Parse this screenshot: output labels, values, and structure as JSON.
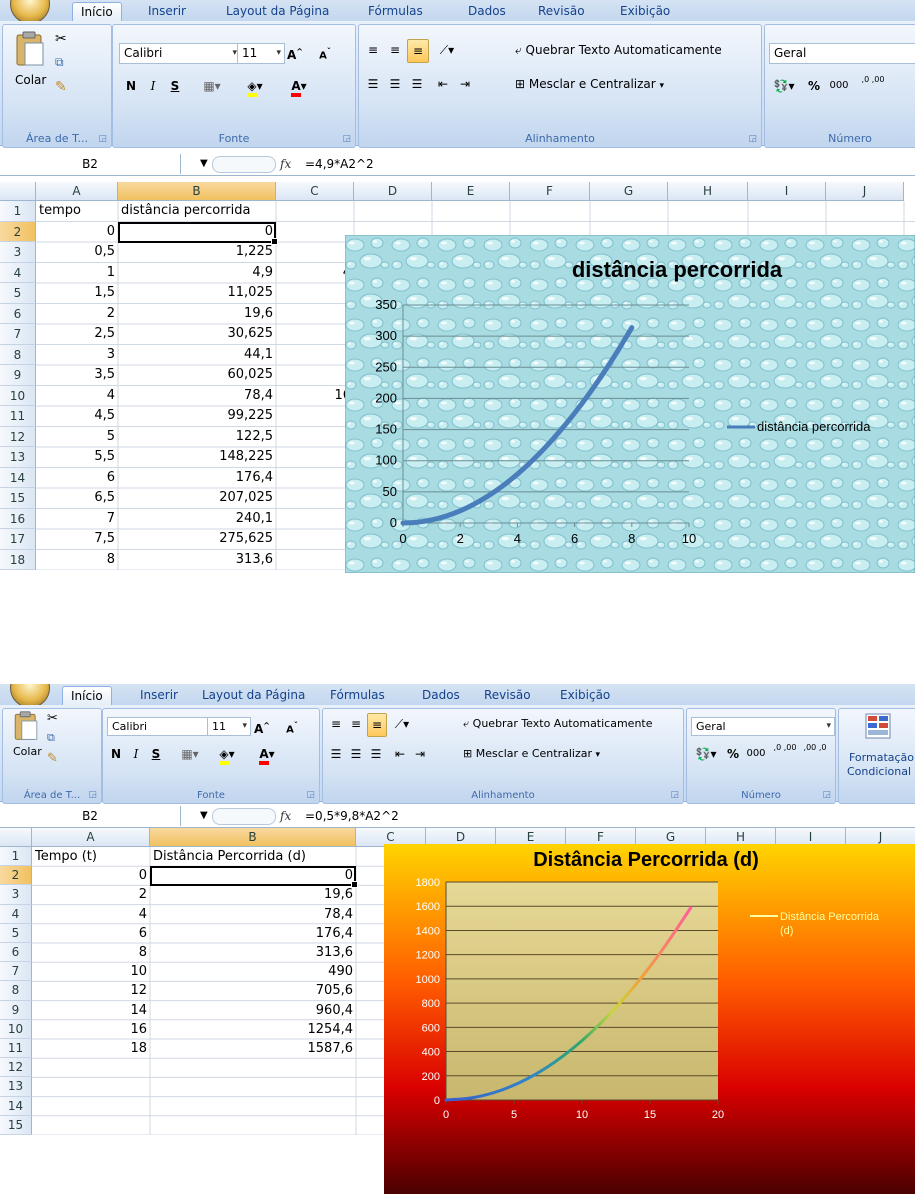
{
  "ribbon": {
    "tabs": [
      "Início",
      "Inserir",
      "Layout da Página",
      "Fórmulas",
      "Dados",
      "Revisão",
      "Exibição"
    ],
    "clipboard": {
      "paste_label": "Colar",
      "group_label": "Área de T..."
    },
    "font": {
      "name": "Calibri",
      "size": "11",
      "bold": "N",
      "italic": "I",
      "underline": "S",
      "group_label": "Fonte"
    },
    "alignment": {
      "wrap_text": "Quebrar Texto Automaticamente",
      "merge_center": "Mesclar e Centralizar",
      "group_label": "Alinhamento"
    },
    "number": {
      "format": "Geral",
      "percent": "%",
      "thousands": "000",
      "inc_decimal": ",0 ,00",
      "dec_decimal": ",00 ,0",
      "group_label": "Número"
    },
    "styles": {
      "conditional_formatting_line1": "Formatação",
      "conditional_formatting_line2": "Condicional"
    }
  },
  "sheet1": {
    "name_box": "B2",
    "formula": "=4,9*A2^2",
    "columns": [
      "A",
      "B",
      "C",
      "D",
      "E",
      "F",
      "G",
      "H",
      "I",
      "J"
    ],
    "header": {
      "a": "tempo",
      "b": "distância percorrida"
    },
    "rows": [
      {
        "r": "1",
        "a": "tempo",
        "b": "distância percorrida"
      },
      {
        "r": "2",
        "a": "0",
        "b": "0"
      },
      {
        "r": "3",
        "a": "0,5",
        "b": "1,225"
      },
      {
        "r": "4",
        "a": "1",
        "b": "4,9"
      },
      {
        "r": "5",
        "a": "1,5",
        "b": "11,025"
      },
      {
        "r": "6",
        "a": "2",
        "b": "19,6"
      },
      {
        "r": "7",
        "a": "2,5",
        "b": "30,625"
      },
      {
        "r": "8",
        "a": "3",
        "b": "44,1"
      },
      {
        "r": "9",
        "a": "3,5",
        "b": "60,025"
      },
      {
        "r": "10",
        "a": "4",
        "b": "78,4"
      },
      {
        "r": "11",
        "a": "4,5",
        "b": "99,225"
      },
      {
        "r": "12",
        "a": "5",
        "b": "122,5"
      },
      {
        "r": "13",
        "a": "5,5",
        "b": "148,225"
      },
      {
        "r": "14",
        "a": "6",
        "b": "176,4"
      },
      {
        "r": "15",
        "a": "6,5",
        "b": "207,025"
      },
      {
        "r": "16",
        "a": "7",
        "b": "240,1"
      },
      {
        "r": "17",
        "a": "7,5",
        "b": "275,625"
      },
      {
        "r": "18",
        "a": "8",
        "b": "313,6"
      }
    ],
    "peeking_c4": "4",
    "peeking_c10": "16"
  },
  "sheet2": {
    "name_box": "B2",
    "formula": "=0,5*9,8*A2^2",
    "columns": [
      "A",
      "B",
      "C",
      "D",
      "E",
      "F",
      "G",
      "H",
      "I",
      "J"
    ],
    "rows": [
      {
        "r": "1",
        "a": "Tempo (t)",
        "b": "Distância Percorrida (d)"
      },
      {
        "r": "2",
        "a": "0",
        "b": "0"
      },
      {
        "r": "3",
        "a": "2",
        "b": "19,6"
      },
      {
        "r": "4",
        "a": "4",
        "b": "78,4"
      },
      {
        "r": "5",
        "a": "6",
        "b": "176,4"
      },
      {
        "r": "6",
        "a": "8",
        "b": "313,6"
      },
      {
        "r": "7",
        "a": "10",
        "b": "490"
      },
      {
        "r": "8",
        "a": "12",
        "b": "705,6"
      },
      {
        "r": "9",
        "a": "14",
        "b": "960,4"
      },
      {
        "r": "10",
        "a": "16",
        "b": "1254,4"
      },
      {
        "r": "11",
        "a": "18",
        "b": "1587,6"
      },
      {
        "r": "12",
        "a": "",
        "b": ""
      },
      {
        "r": "13",
        "a": "",
        "b": ""
      },
      {
        "r": "14",
        "a": "",
        "b": ""
      },
      {
        "r": "15",
        "a": "",
        "b": ""
      }
    ]
  },
  "chart_data": [
    {
      "type": "line",
      "title": "distância percorrida",
      "xlabel": "",
      "ylabel": "",
      "x": [
        0,
        0.5,
        1,
        1.5,
        2,
        2.5,
        3,
        3.5,
        4,
        4.5,
        5,
        5.5,
        6,
        6.5,
        7,
        7.5,
        8
      ],
      "series": [
        {
          "name": "distância percorrida",
          "values": [
            0,
            1.225,
            4.9,
            11.025,
            19.6,
            30.625,
            44.1,
            60.025,
            78.4,
            99.225,
            122.5,
            148.225,
            176.4,
            207.025,
            240.1,
            275.625,
            313.6
          ],
          "color": "#4a7ebb"
        }
      ],
      "xlim": [
        0,
        10
      ],
      "ylim": [
        0,
        350
      ],
      "xticks": [
        "0",
        "2",
        "4",
        "6",
        "8",
        "10"
      ],
      "yticks": [
        "0",
        "50",
        "100",
        "150",
        "200",
        "250",
        "300",
        "350"
      ],
      "grid": true,
      "legend": "right",
      "background": "water-droplets texture"
    },
    {
      "type": "line",
      "title": "Distância Percorrida (d)",
      "xlabel": "",
      "ylabel": "",
      "x": [
        0,
        2,
        4,
        6,
        8,
        10,
        12,
        14,
        16,
        18
      ],
      "series": [
        {
          "name": "Distância Percorrida (d)",
          "values": [
            0,
            19.6,
            78.4,
            176.4,
            313.6,
            490,
            705.6,
            960.4,
            1254.4,
            1587.6
          ],
          "color": "rainbow gradient"
        }
      ],
      "xlim": [
        0,
        20
      ],
      "ylim": [
        0,
        1800
      ],
      "xticks": [
        "0",
        "5",
        "10",
        "15",
        "20"
      ],
      "yticks": [
        "0",
        "200",
        "400",
        "600",
        "800",
        "1000",
        "1200",
        "1400",
        "1600",
        "1800"
      ],
      "grid": true,
      "legend": "right",
      "background": "yellow-to-red-to-dark gradient"
    }
  ]
}
